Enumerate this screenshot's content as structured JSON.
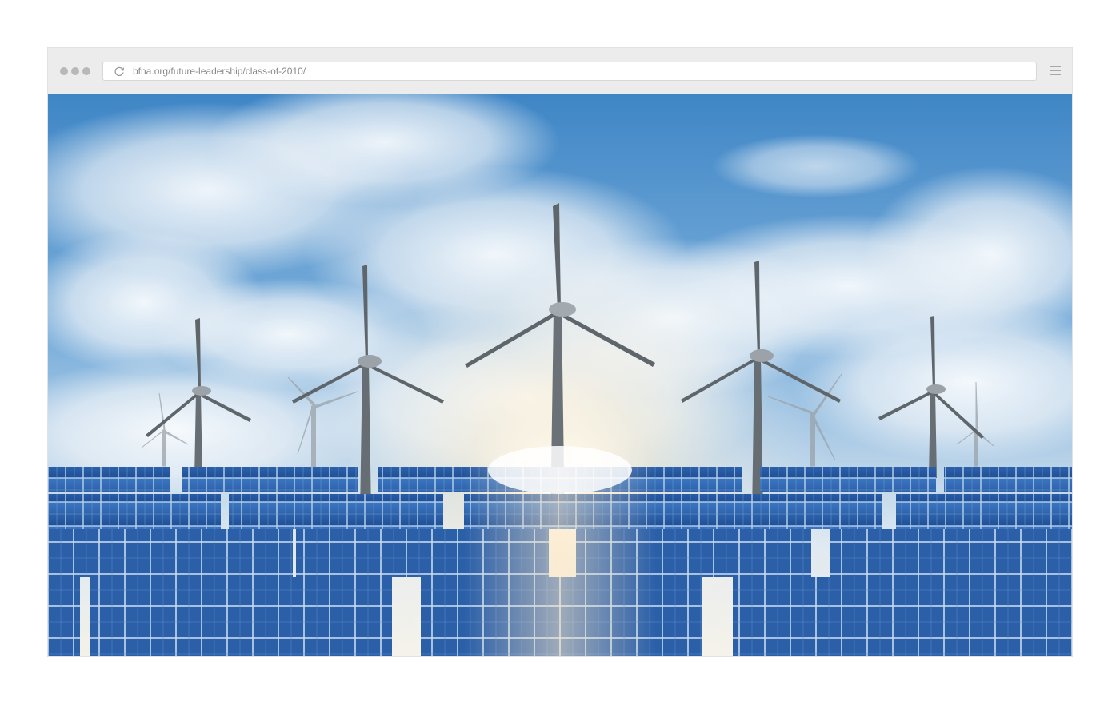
{
  "browser": {
    "address_bar": {
      "url": "bfna.org/future-leadership/class-of-2010/"
    },
    "icons": {
      "window_controls": "window-dots-icon",
      "reload": "reload-icon",
      "menu": "hamburger-menu-icon"
    }
  },
  "hero_image": {
    "subject": "wind-turbines-and-solar-panels",
    "colors": {
      "sky_top": "#3f86c6",
      "cloud": "#f3f6f9",
      "sun": "#fff8e8",
      "panel": "#2f66b0",
      "panel_frame": "#b9d2ea",
      "turbine": "#6d7479"
    }
  }
}
